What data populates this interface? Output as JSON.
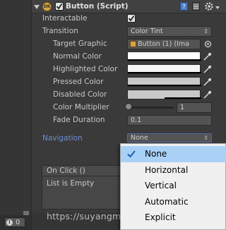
{
  "component": {
    "title": "Button (Script)",
    "enabled": true,
    "script_badge": "OK"
  },
  "fields": {
    "interactable_label": "Interactable",
    "transition_label": "Transition",
    "transition_value": "Color Tint",
    "target_graphic_label": "Target Graphic",
    "target_graphic_value": "Button (1) (Ima",
    "normal_color_label": "Normal Color",
    "highlighted_color_label": "Highlighted Color",
    "pressed_color_label": "Pressed Color",
    "disabled_color_label": "Disabled Color",
    "color_multiplier_label": "Color Multiplier",
    "color_multiplier_value": "1",
    "color_multiplier_fraction": 0.0,
    "fade_duration_label": "Fade Duration",
    "fade_duration_value": "0.1",
    "navigation_label": "Navigation",
    "navigation_value": "None"
  },
  "colors": {
    "normal": "#ffffff",
    "highlighted": "#f5f5f5",
    "pressed": "#c8c8c8",
    "disabled": "#c8c8c8",
    "navigation_label": "#6f8fd6",
    "menu_highlight": "#a9d1f5"
  },
  "navigation_menu": {
    "items": [
      "None",
      "Horizontal",
      "Vertical",
      "Automatic",
      "Explicit"
    ],
    "selected": "None"
  },
  "on_click": {
    "header": "On Click ()",
    "empty_text": "List is Empty"
  },
  "status": {
    "error_count": "0"
  },
  "watermark": "https://suyangmagic.blog.csdn.net"
}
